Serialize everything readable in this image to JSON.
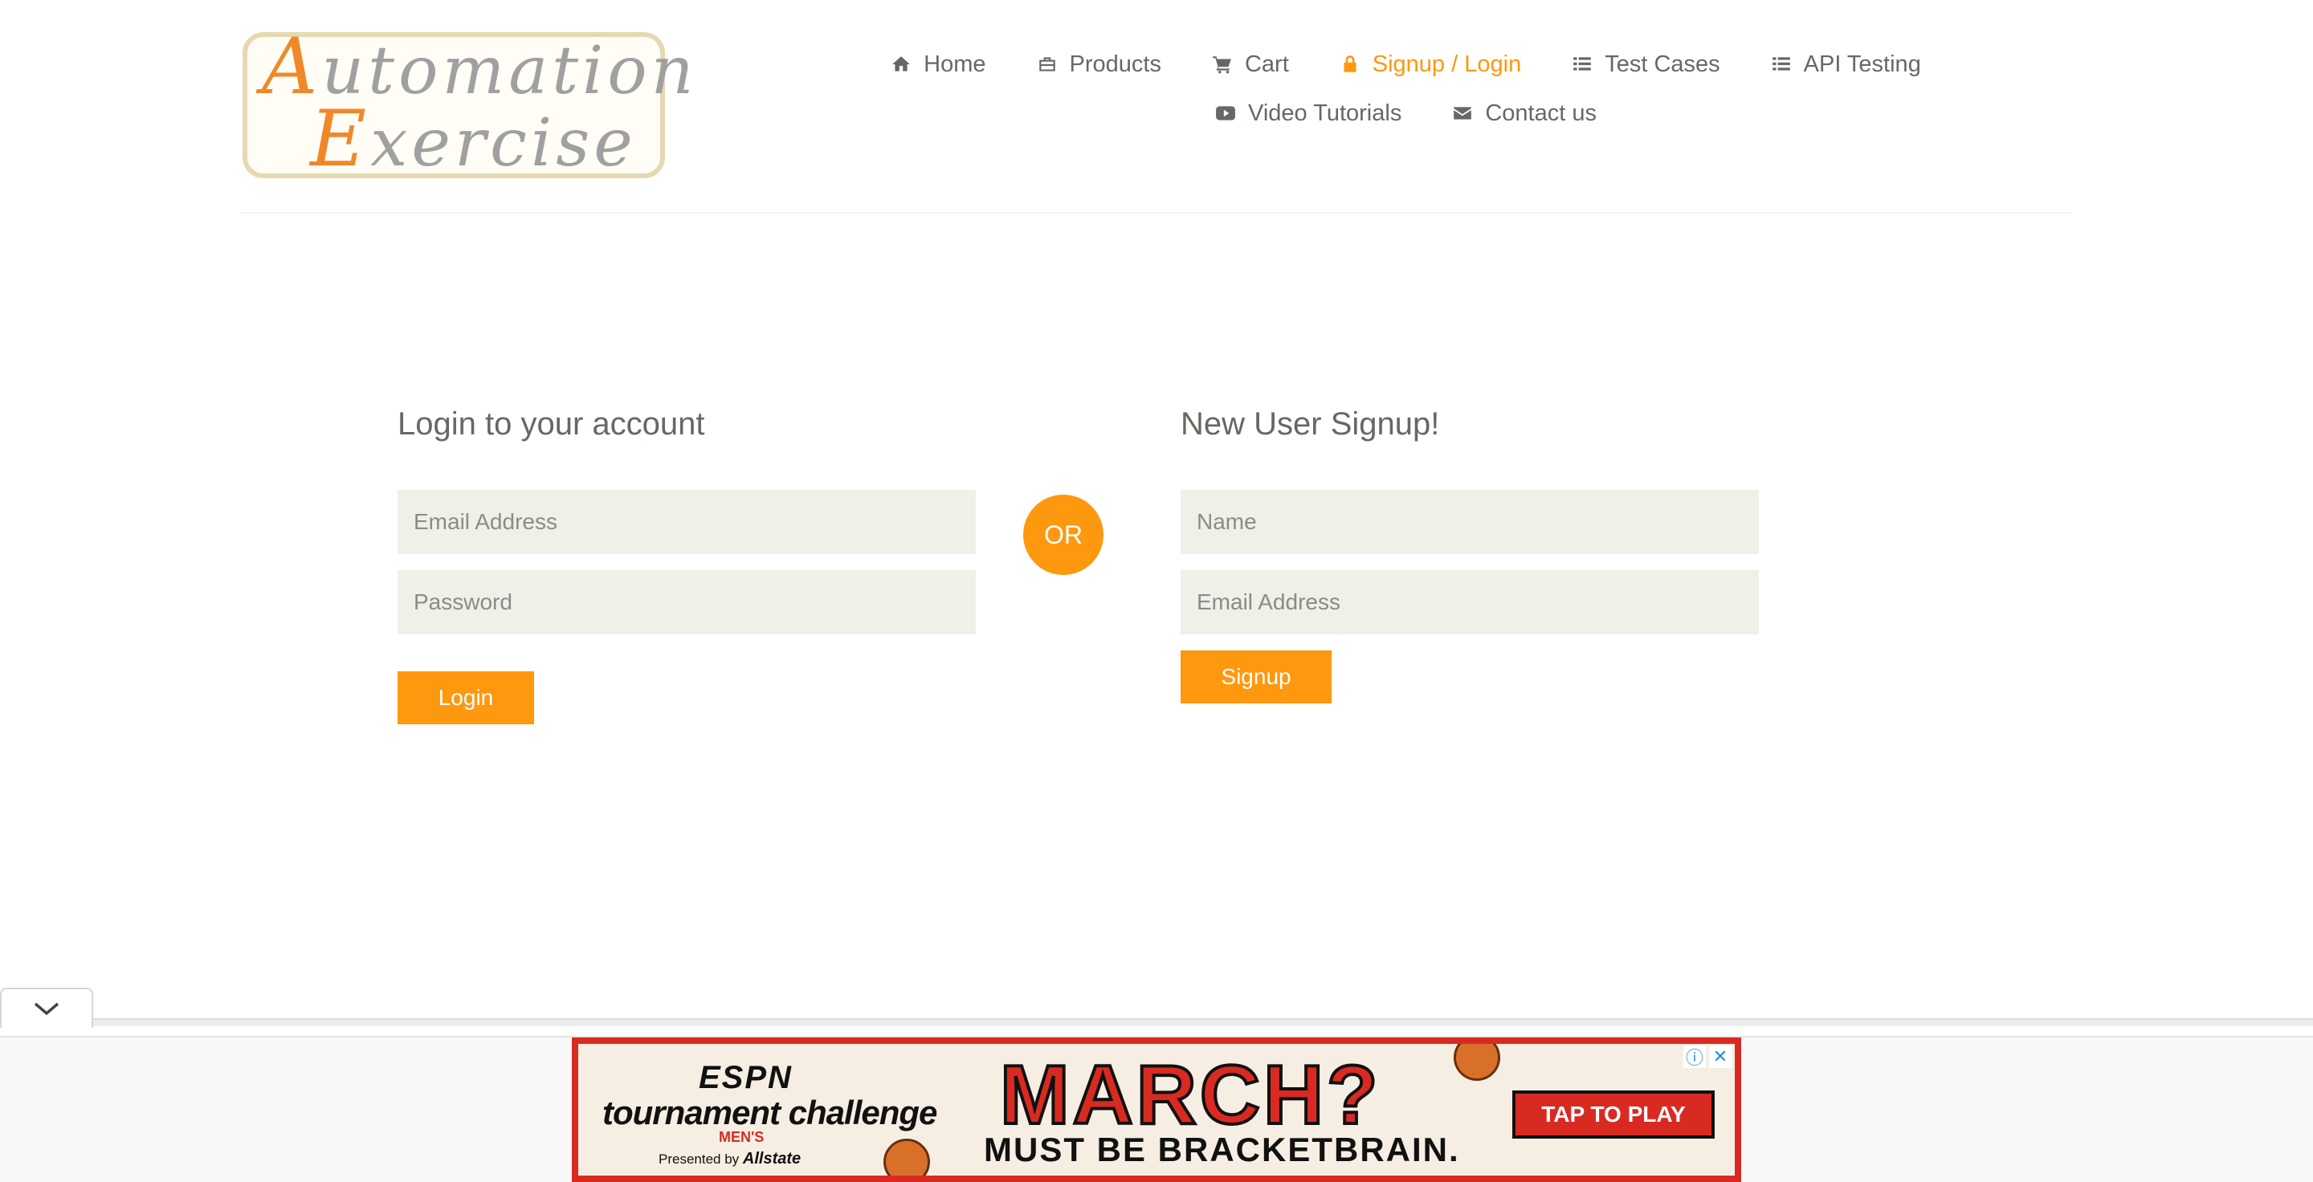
{
  "logo": {
    "line1_cap": "A",
    "line1_rest": "utomation",
    "line2_cap": "E",
    "line2_rest": "xercise"
  },
  "nav": {
    "row1": [
      {
        "label": "Home",
        "icon": "home-icon"
      },
      {
        "label": "Products",
        "icon": "briefcase-icon"
      },
      {
        "label": "Cart",
        "icon": "cart-icon"
      },
      {
        "label": "Signup / Login",
        "icon": "lock-icon",
        "active": true
      },
      {
        "label": "Test Cases",
        "icon": "list-icon"
      },
      {
        "label": "API Testing",
        "icon": "list-icon"
      }
    ],
    "row2": [
      {
        "label": "Video Tutorials",
        "icon": "youtube-play-icon"
      },
      {
        "label": "Contact us",
        "icon": "envelope-icon"
      }
    ]
  },
  "login": {
    "title": "Login to your account",
    "email_placeholder": "Email Address",
    "password_placeholder": "Password",
    "button": "Login"
  },
  "or_label": "OR",
  "signup": {
    "title": "New User Signup!",
    "name_placeholder": "Name",
    "email_placeholder": "Email Address",
    "button": "Signup"
  },
  "ad": {
    "brand": "ESPN",
    "product": "tournament challenge",
    "tag": "MEN'S",
    "presented_by": "Presented by",
    "sponsor": "Allstate",
    "headline": "MARCH?",
    "subline": "MUST BE BRACKETBRAIN.",
    "cta": "TAP TO PLAY",
    "info_icon": "info-icon",
    "close_icon": "close-icon"
  },
  "colors": {
    "accent": "#fe980f",
    "text": "#696763",
    "field_bg": "#f0f0e9",
    "ad_red": "#d92a22"
  }
}
